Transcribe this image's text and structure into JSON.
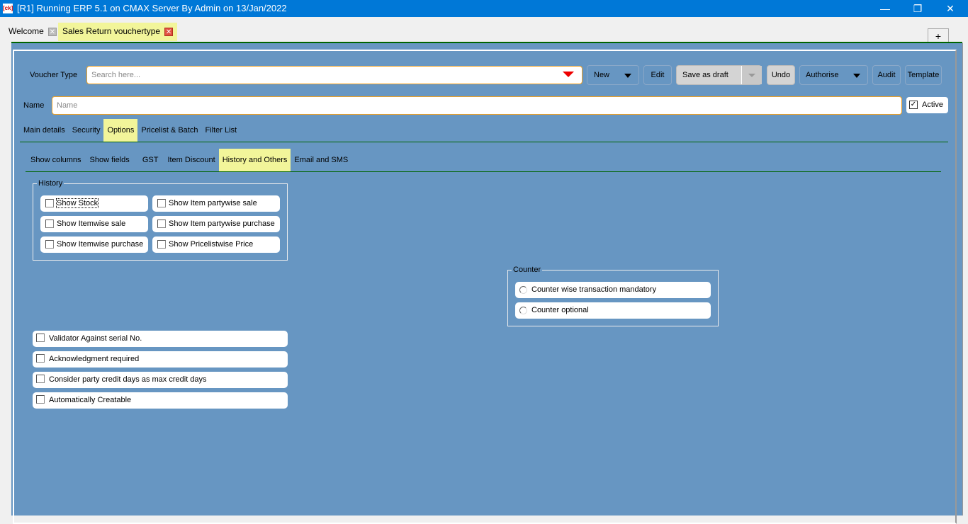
{
  "window": {
    "title": "[R1] Running ERP 5.1 on CMAX Server By Admin on 13/Jan/2022",
    "logo": "CK"
  },
  "tabs": [
    {
      "label": "Welcome"
    },
    {
      "label": "Sales Return vouchertype"
    }
  ],
  "add_tab": "+",
  "toolbar": {
    "voucher_type_label": "Voucher Type",
    "search_placeholder": "Search here...",
    "new": "New",
    "edit": "Edit",
    "save_draft": "Save as draft",
    "undo": "Undo",
    "authorise": "Authorise",
    "audit": "Audit",
    "template": "Template"
  },
  "name": {
    "label": "Name",
    "placeholder": "Name",
    "active_label": "Active",
    "active_checked": true
  },
  "main_tabs": [
    "Main details",
    "Security",
    "Options",
    "Pricelist & Batch",
    "Filter List"
  ],
  "sub_tabs": [
    "Show columns",
    "Show fields",
    "GST",
    "Item Discount",
    "History and Others",
    "Email and SMS"
  ],
  "history": {
    "legend": "History",
    "items": [
      "Show Stock",
      "Show Item partywise sale",
      "Show Itemwise sale",
      "Show Item partywise purchase",
      "Show Itemwise purchase",
      "Show Pricelistwise Price"
    ]
  },
  "counter": {
    "legend": "Counter",
    "options": [
      "Counter wise transaction mandatory",
      "Counter optional"
    ]
  },
  "others": [
    "Validator Against serial No.",
    "Acknowledgment required",
    "Consider party credit days as max credit days",
    "Automatically Creatable"
  ],
  "colors": {
    "panel": "#6796c2",
    "selected": "#f2f59a",
    "titlebar": "#0078d7"
  }
}
